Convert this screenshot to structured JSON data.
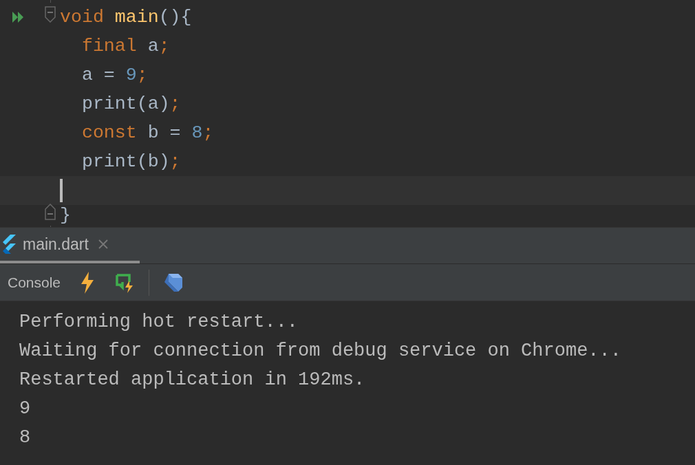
{
  "editor": {
    "lines": [
      {
        "current": false,
        "tokens": [
          {
            "text": "void ",
            "kind": "keyword"
          },
          {
            "text": "main",
            "kind": "function"
          },
          {
            "text": "(){",
            "kind": "plain"
          }
        ]
      },
      {
        "current": false,
        "tokens": [
          {
            "text": "  final",
            "kind": "keyword"
          },
          {
            "text": " a",
            "kind": "plain"
          },
          {
            "text": ";",
            "kind": "punct"
          }
        ]
      },
      {
        "current": false,
        "tokens": [
          {
            "text": "  a = ",
            "kind": "plain"
          },
          {
            "text": "9",
            "kind": "number"
          },
          {
            "text": ";",
            "kind": "punct"
          }
        ]
      },
      {
        "current": false,
        "tokens": [
          {
            "text": "  print(a)",
            "kind": "plain"
          },
          {
            "text": ";",
            "kind": "punct"
          }
        ]
      },
      {
        "current": false,
        "tokens": [
          {
            "text": "  const",
            "kind": "keyword"
          },
          {
            "text": " b = ",
            "kind": "plain"
          },
          {
            "text": "8",
            "kind": "number"
          },
          {
            "text": ";",
            "kind": "punct"
          }
        ]
      },
      {
        "current": false,
        "tokens": [
          {
            "text": "  print(b)",
            "kind": "plain"
          },
          {
            "text": ";",
            "kind": "punct"
          }
        ]
      },
      {
        "current": true
      },
      {
        "current": false,
        "tokens": [
          {
            "text": "}",
            "kind": "plain"
          }
        ]
      }
    ]
  },
  "run_tabs": [
    {
      "label": "main.dart",
      "selected": true
    }
  ],
  "toolbar": {
    "label": "Console"
  },
  "console": {
    "lines": [
      "Performing hot restart...",
      "Waiting for connection from debug service on Chrome...",
      "Restarted application in 192ms.",
      "9",
      "8"
    ]
  }
}
